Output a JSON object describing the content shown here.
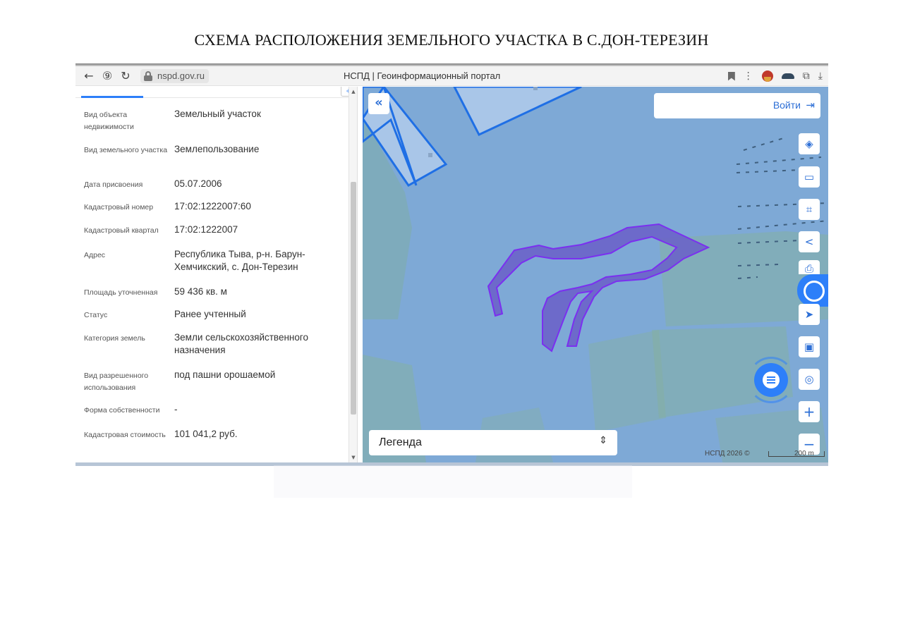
{
  "doc_title": "СХЕМА РАСПОЛОЖЕНИЯ ЗЕМЕЛЬНОГО УЧАСТКА В С.ДОН-ТЕРЕЗИН",
  "browser": {
    "url": "nspd.gov.ru",
    "page_title": "НСПД | Геоинформационный портал"
  },
  "panel": {
    "rows": [
      {
        "label": "Вид объекта недвижимости",
        "value": "Земельный участок"
      },
      {
        "label": "Вид земельного участка",
        "value": "Землепользование"
      },
      {
        "label": "Дата присвоения",
        "value": "05.07.2006"
      },
      {
        "label": "Кадастровый номер",
        "value": "17:02:1222007:60"
      },
      {
        "label": "Кадастровый квартал",
        "value": "17:02:1222007"
      },
      {
        "label": "Адрес",
        "value": "Республика Тыва, р-н. Барун-Хемчикский, с. Дон-Терезин"
      },
      {
        "label": "Площадь уточненная",
        "value": "59 436 кв. м"
      },
      {
        "label": "Статус",
        "value": "Ранее учтенный"
      },
      {
        "label": "Категория земель",
        "value": "Земли сельскохозяйственного назначения"
      },
      {
        "label": "Вид разрешенного использования",
        "value": "под пашни орошаемой"
      },
      {
        "label": "Форма собственности",
        "value": "-"
      },
      {
        "label": "Кадастровая стоимость",
        "value": "101 041,2 руб."
      }
    ]
  },
  "map": {
    "login_label": "Войти",
    "legend_label": "Легенда",
    "attribution": "НСПД 2026 ©",
    "scale_label": "200 m",
    "colors": {
      "map_bg": "#7ea9d6",
      "parcel_fill": "#6a5fc8",
      "parcel_stroke": "#7b2ff0",
      "accent": "#2d7ff9"
    }
  }
}
